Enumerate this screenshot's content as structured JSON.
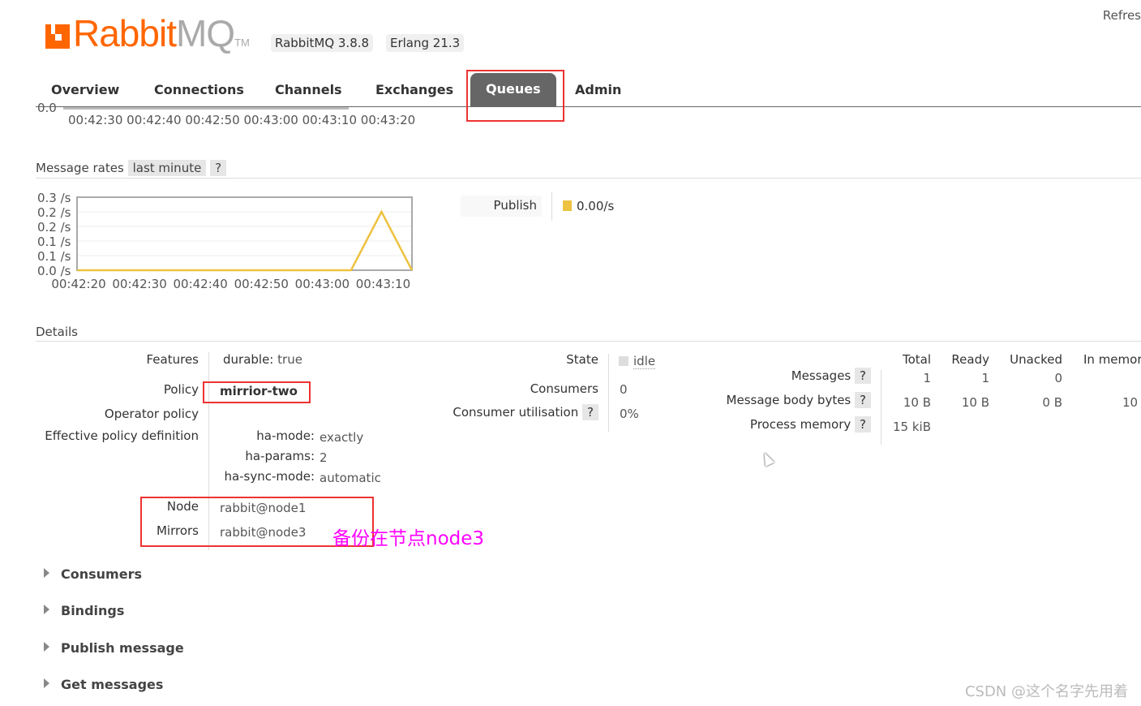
{
  "header": {
    "logo_text_orange": "Rabbit",
    "logo_text_grey": "MQ",
    "logo_tm": "TM",
    "version_badge": "RabbitMQ 3.8.8",
    "erlang_badge": "Erlang 21.3",
    "refresh_label": "Refres"
  },
  "nav": {
    "tabs": [
      {
        "label": "Overview"
      },
      {
        "label": "Connections"
      },
      {
        "label": "Channels"
      },
      {
        "label": "Exchanges"
      },
      {
        "label": "Queues",
        "active": true
      },
      {
        "label": "Admin"
      }
    ]
  },
  "top_chart_remnant": {
    "y_tick": "0.0",
    "x_ticks": [
      "00:42:30",
      "00:42:40",
      "00:42:50",
      "00:43:00",
      "00:43:10",
      "00:43:20"
    ]
  },
  "message_rates": {
    "title": "Message rates",
    "range": "last minute",
    "help": "?",
    "legend": [
      {
        "label": "Publish",
        "value": "0.00/s",
        "color": "#edc240"
      }
    ]
  },
  "chart_data": {
    "type": "line",
    "x": [
      "00:42:20",
      "00:42:30",
      "00:42:40",
      "00:42:50",
      "00:43:00",
      "00:43:05",
      "00:43:10",
      "00:43:15"
    ],
    "series": [
      {
        "name": "Publish",
        "values": [
          0,
          0,
          0,
          0,
          0,
          0,
          0.2,
          0
        ],
        "color": "#edc240"
      }
    ],
    "x_ticks": [
      "00:42:20",
      "00:42:30",
      "00:42:40",
      "00:42:50",
      "00:43:00",
      "00:43:10"
    ],
    "y_ticks": [
      "0.3 /s",
      "0.2 /s",
      "0.2 /s",
      "0.1 /s",
      "0.1 /s",
      "0.0 /s"
    ],
    "ylim": [
      0,
      0.25
    ],
    "grid": true
  },
  "details": {
    "title": "Details",
    "features_label": "Features",
    "features_key": "durable:",
    "features_val": "true",
    "policy_label": "Policy",
    "policy_val": "mirrior-two",
    "operator_policy_label": "Operator policy",
    "effective_label": "Effective policy definition",
    "effective": [
      {
        "k": "ha-mode:",
        "v": "exactly"
      },
      {
        "k": "ha-params:",
        "v": "2"
      },
      {
        "k": "ha-sync-mode:",
        "v": "automatic"
      }
    ],
    "node_label": "Node",
    "node_val": "rabbit@node1",
    "mirrors_label": "Mirrors",
    "mirrors_val": "rabbit@node3",
    "state_label": "State",
    "state_val": "idle",
    "consumers_label": "Consumers",
    "consumers_val": "0",
    "util_label": "Consumer utilisation",
    "util_val": "0%",
    "stats_headers": [
      "Total",
      "Ready",
      "Unacked",
      "In memor"
    ],
    "messages_label": "Messages",
    "messages": [
      "1",
      "1",
      "0",
      ""
    ],
    "bytes_label": "Message body bytes",
    "bytes": [
      "10 B",
      "10 B",
      "0 B",
      "10"
    ],
    "memory_label": "Process memory",
    "memory_val": "15 kiB"
  },
  "annotation": "备份在节点node3",
  "expanders": [
    "Consumers",
    "Bindings",
    "Publish message",
    "Get messages"
  ],
  "watermark": "CSDN @这个名字先用着"
}
